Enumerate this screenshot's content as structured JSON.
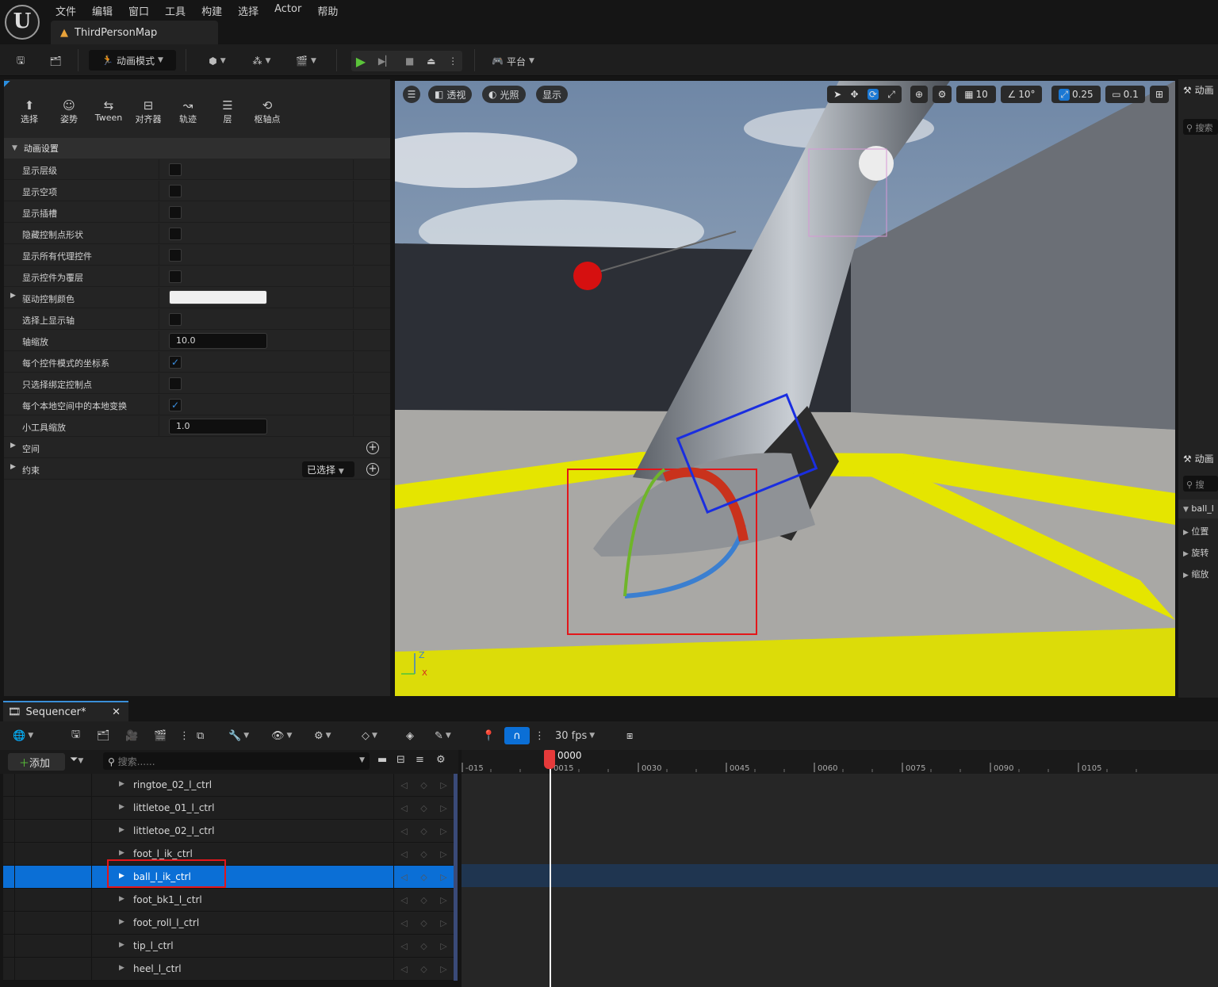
{
  "menu": [
    "文件",
    "编辑",
    "窗口",
    "工具",
    "构建",
    "选择",
    "Actor",
    "帮助"
  ],
  "map_tab": "ThirdPersonMap",
  "toolbar": {
    "mode": "动画模式",
    "platform": "平台"
  },
  "panel_tools": [
    {
      "icon": "select-icon",
      "label": "选择"
    },
    {
      "icon": "pose-icon",
      "label": "姿势"
    },
    {
      "icon": "tween-icon",
      "label": "Tween"
    },
    {
      "icon": "aligner-icon",
      "label": "对齐器"
    },
    {
      "icon": "trail-icon",
      "label": "轨迹"
    },
    {
      "icon": "layer-icon",
      "label": "层"
    },
    {
      "icon": "pivot-icon",
      "label": "枢轴点"
    }
  ],
  "anim_settings": {
    "header": "动画设置",
    "rows": [
      {
        "label": "显示层级",
        "type": "check",
        "checked": false
      },
      {
        "label": "显示空项",
        "type": "check",
        "checked": false
      },
      {
        "label": "显示插槽",
        "type": "check",
        "checked": false
      },
      {
        "label": "隐藏控制点形状",
        "type": "check",
        "checked": false
      },
      {
        "label": "显示所有代理控件",
        "type": "check",
        "checked": false
      },
      {
        "label": "显示控件为覆层",
        "type": "check",
        "checked": false
      },
      {
        "label": "驱动控制颜色",
        "type": "color",
        "value": "#f0f0f0"
      },
      {
        "label": "选择上显示轴",
        "type": "check",
        "checked": false
      },
      {
        "label": "轴缩放",
        "type": "number",
        "value": "10.0"
      },
      {
        "label": "每个控件模式的坐标系",
        "type": "check",
        "checked": true
      },
      {
        "label": "只选择绑定控制点",
        "type": "check",
        "checked": false
      },
      {
        "label": "每个本地空间中的本地变换",
        "type": "check",
        "checked": true
      },
      {
        "label": "小工具缩放",
        "type": "number",
        "value": "1.0"
      }
    ],
    "space_label": "空间",
    "constraint_label": "约束",
    "constraint_select": "已选择"
  },
  "viewport": {
    "perspective": "透视",
    "lighting": "光照",
    "show": "显示",
    "grid_snap": "10",
    "rot_snap": "10°",
    "scale_snap": "0.25",
    "cam_speed": "0.1",
    "axis_z": "Z",
    "axis_x": "X"
  },
  "right_panel": {
    "title1": "动画",
    "search1": "搜索",
    "title2": "动画",
    "search2": "搜",
    "selected": "ball_l",
    "items": [
      "位置",
      "旋转",
      "缩放"
    ]
  },
  "sequencer": {
    "tab": "Sequencer*",
    "fps": "30 fps",
    "add": "添加",
    "search_placeholder": "搜索......",
    "current_frame": "0000",
    "ruler": [
      "-015",
      "0015",
      "0030",
      "0045",
      "0060",
      "0075",
      "0090",
      "0105"
    ],
    "tracks": [
      "ringtoe_02_l_ctrl",
      "littletoe_01_l_ctrl",
      "littletoe_02_l_ctrl",
      "foot_l_ik_ctrl",
      "ball_l_ik_ctrl",
      "foot_bk1_l_ctrl",
      "foot_roll_l_ctrl",
      "tip_l_ctrl",
      "heel_l_ctrl"
    ],
    "selected_track": "ball_l_ik_ctrl"
  }
}
